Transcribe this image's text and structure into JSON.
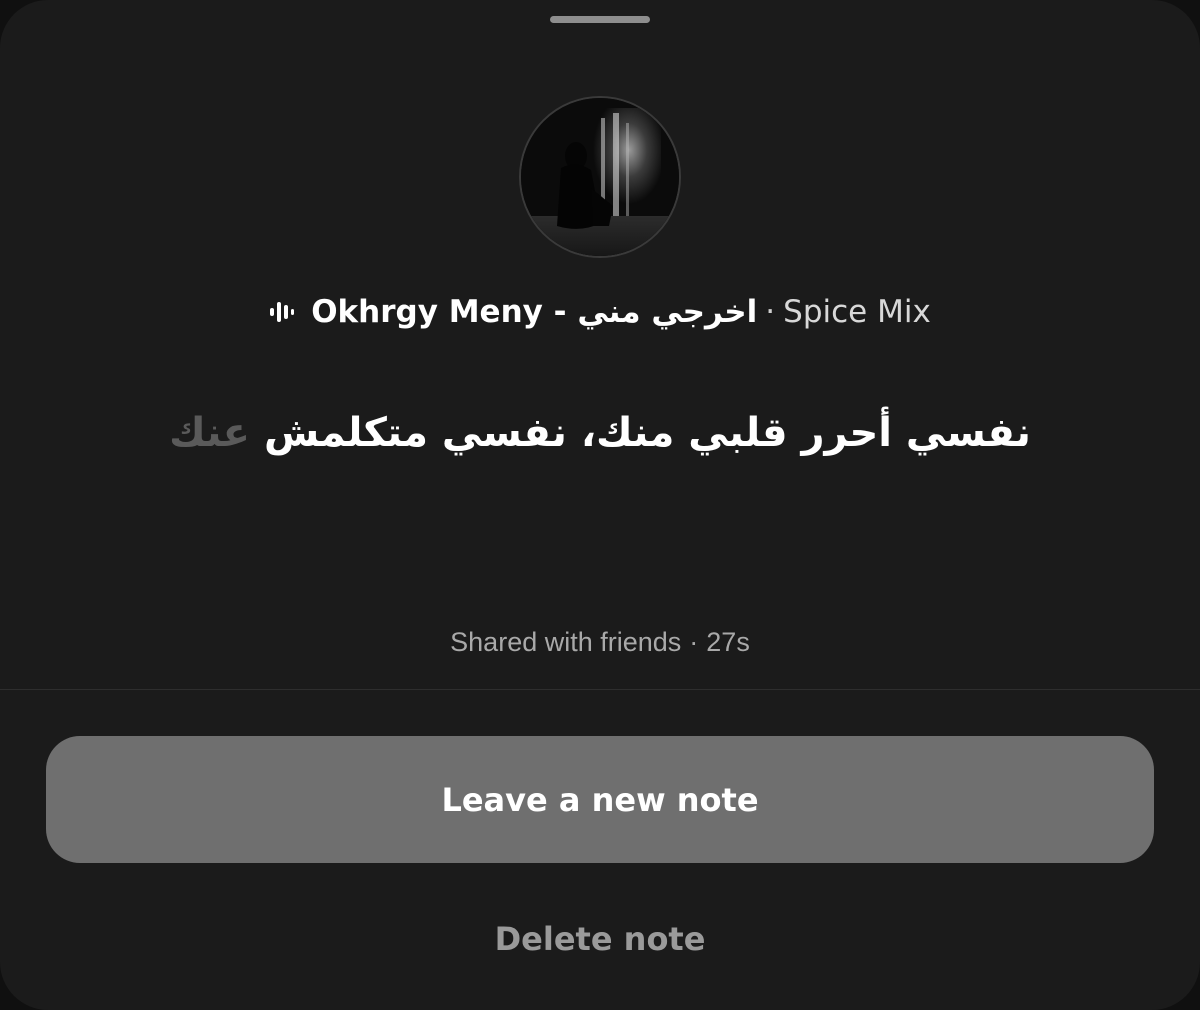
{
  "note": {
    "song_title": "Okhrgy Meny - اخرجي مني",
    "separator": "·",
    "artist": "Spice Mix",
    "lyric_sung": "نفسي أحرر قلبي منك، نفسي متكلمش",
    "lyric_unsung": "عنك",
    "shared_text": "Shared with friends",
    "shared_separator": "·",
    "time_ago": "27s"
  },
  "actions": {
    "leave_new_note": "Leave a new note",
    "delete_note": "Delete note"
  },
  "icons": {
    "music": "sound-wave-icon",
    "avatar": "profile-photo"
  },
  "colors": {
    "sheet_background": "#1b1b1b",
    "button_background": "#6f6f6f",
    "lyric_unsung": "#5a5a5a",
    "secondary_text": "#a9a9a9"
  }
}
